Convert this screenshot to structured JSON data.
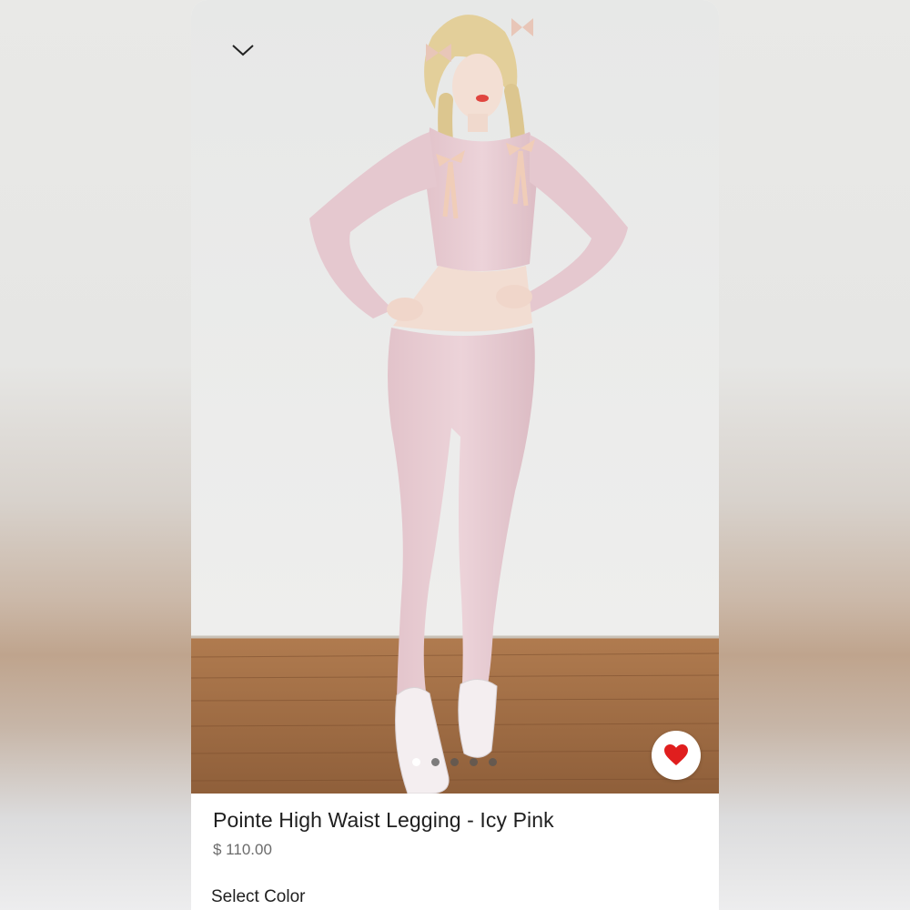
{
  "product": {
    "title": "Pointe High Waist Legging - Icy Pink",
    "price": "$ 110.00",
    "favorited": true
  },
  "gallery": {
    "image_count": 5,
    "active_index": 0
  },
  "options": {
    "select_color_label": "Select Color"
  },
  "icons": {
    "collapse": "chevron-down-icon",
    "favorite": "heart-icon"
  },
  "colors": {
    "heart": "#e01e1e",
    "title_text": "#1f1f1f",
    "price_text": "#6b6b6b",
    "garment": "#e9cdd3"
  }
}
